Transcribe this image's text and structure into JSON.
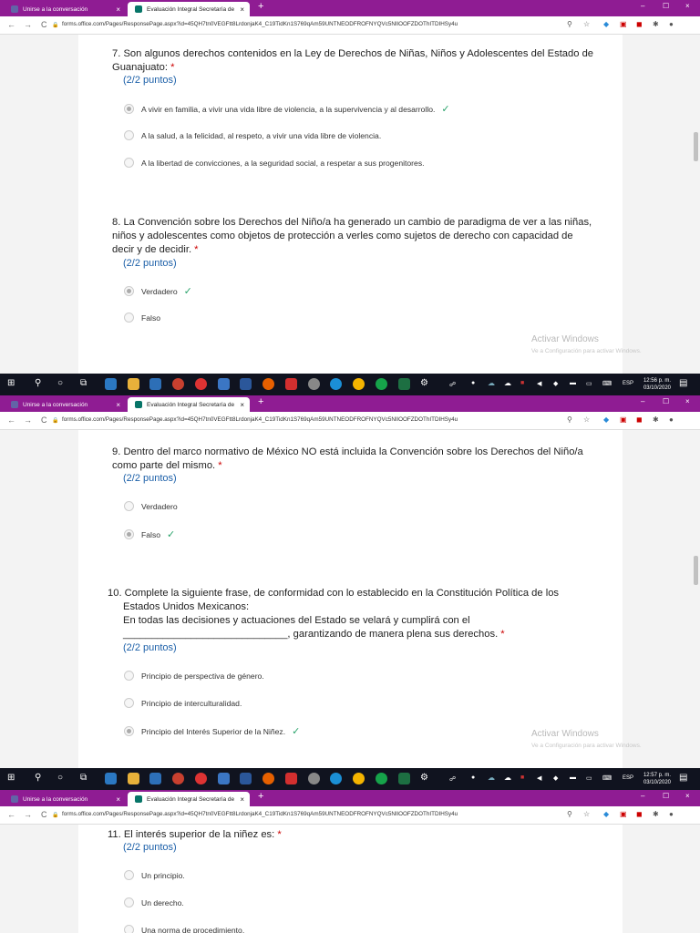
{
  "browser": {
    "tab1": "Unirse a la conversación",
    "tab2": "Evaluación Integral Secretaría de",
    "url": "forms.office.com/Pages/ResponsePage.aspx?id=45QH7tn0VEGFtt8LrdonjaK4_C19TidKn1S769qAm59UNTNEODFROFNYQVc5NlIOOFZDOThITDIHSy4u",
    "new_tab": "+",
    "tab_close": "×",
    "min": "–",
    "max": "☐",
    "close": "×",
    "back": "←",
    "fwd": "→",
    "reload": "C",
    "lock": "🔒"
  },
  "questions": {
    "q7": {
      "text": "7. Son algunos derechos contenidos en la Ley de Derechos de Niñas, Niños y Adolescentes del Estado de Guanajuato:",
      "points": "(2/2 puntos)",
      "options": [
        "A vivir en familia, a vivir una vida libre de violencia, a la supervivencia y al desarrollo.",
        "A la salud, a la felicidad, al respeto, a vivir una vida libre de violencia.",
        "A la libertad de convicciones, a la seguridad social, a respetar a sus progenitores."
      ]
    },
    "q8": {
      "text": "8. La Convención sobre los Derechos del Niño/a ha generado un cambio de paradigma de ver a las niñas, niños y adolescentes como objetos de protección a verles como sujetos de derecho con capacidad de decir y de decidir.",
      "points": "(2/2 puntos)",
      "options": [
        "Verdadero",
        "Falso"
      ]
    },
    "q9": {
      "text": "9. Dentro del marco normativo de México NO está incluida la Convención sobre los Derechos del Niño/a como parte del mismo.",
      "points": "(2/2 puntos)",
      "options": [
        "Verdadero",
        "Falso"
      ]
    },
    "q10": {
      "line1": "10. Complete la siguiente frase, de conformidad con lo establecido en la Constitución Política de los",
      "line2": "Estados Unidos Mexicanos:",
      "line3": "En todas las decisiones y actuaciones del Estado se velará y cumplirá con el",
      "line4": "_____________________________, garantizando de manera plena sus derechos.",
      "points": "(2/2 puntos)",
      "options": [
        "Principio de perspectiva de género.",
        "Principio de interculturalidad.",
        "Principio del Interés Superior de la Niñez."
      ]
    },
    "q11": {
      "text": "11. El interés superior de la niñez es:",
      "points": "(2/2 puntos)",
      "options": [
        "Un principio.",
        "Un derecho.",
        "Una norma de procedimiento."
      ]
    },
    "required_mark": "*",
    "check": "✓"
  },
  "watermark": {
    "title": "Activar Windows",
    "subtitle": "Ve a Configuración para activar Windows."
  },
  "taskbar": {
    "lang": "ESP",
    "time1": "12:56 p. m.",
    "time2": "12:57 p. m.",
    "date": "03/10/2020"
  },
  "colors": {
    "chrome_frame": "#8f1c93",
    "points_blue": "#1b5fa8",
    "check_green": "#2aa36b",
    "taskbar": "#10131f"
  }
}
